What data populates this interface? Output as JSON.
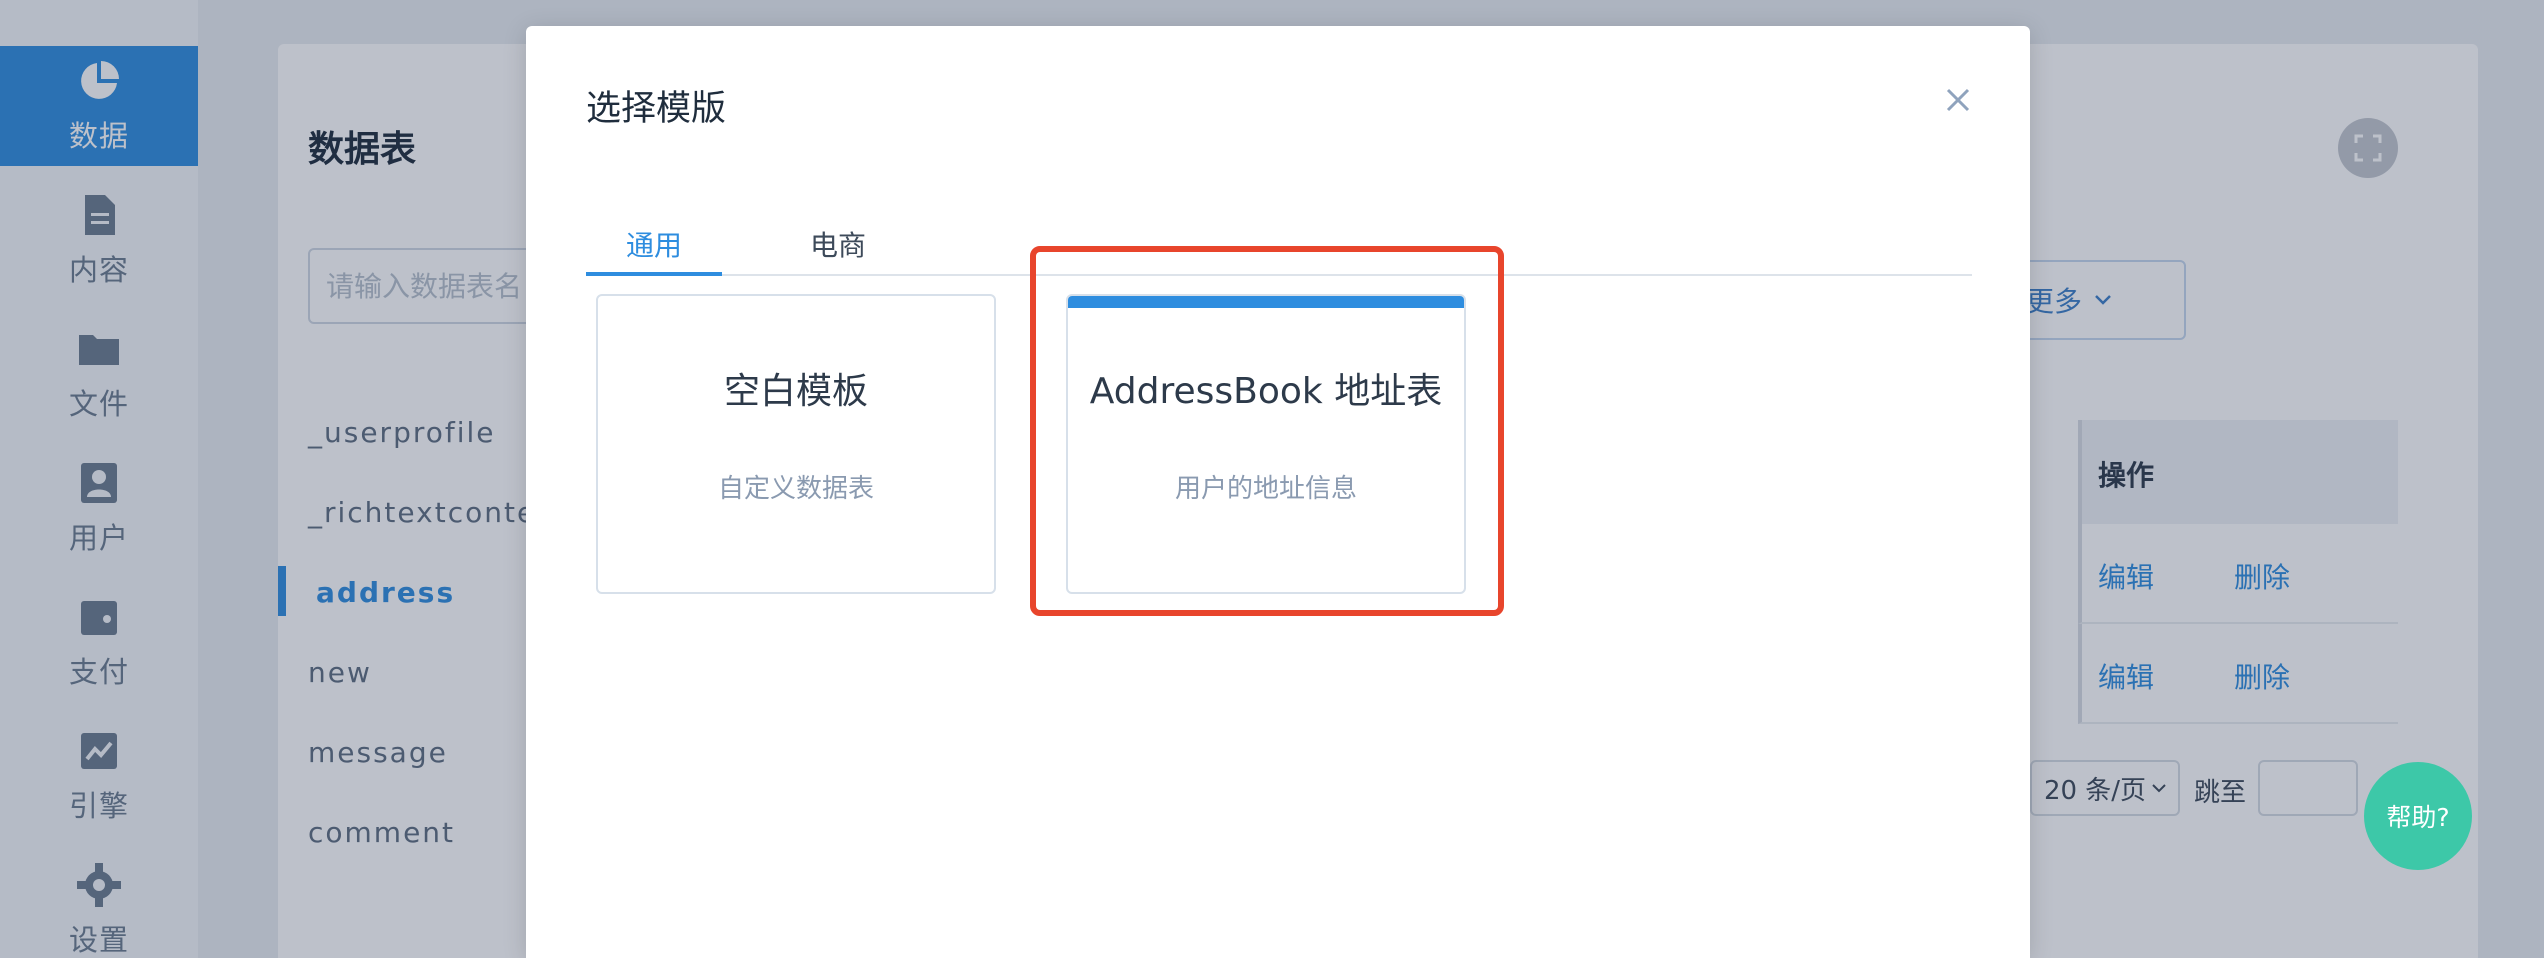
{
  "sidebar": {
    "items": [
      {
        "label": "数据",
        "icon": "pie-chart-icon",
        "active": true
      },
      {
        "label": "内容",
        "icon": "document-icon",
        "active": false
      },
      {
        "label": "文件",
        "icon": "folder-icon",
        "active": false
      },
      {
        "label": "用户",
        "icon": "user-icon",
        "active": false
      },
      {
        "label": "支付",
        "icon": "wallet-icon",
        "active": false
      },
      {
        "label": "引擎",
        "icon": "trend-chart-icon",
        "active": false
      },
      {
        "label": "设置",
        "icon": "gear-icon",
        "active": false
      }
    ]
  },
  "panel": {
    "title": "数据表",
    "search_placeholder": "请输入数据表名",
    "tables": [
      "_userprofile",
      "_richtextconter",
      "address",
      "new",
      "message",
      "comment"
    ],
    "active_table": "address"
  },
  "toolbar": {
    "more_label": "更多"
  },
  "table": {
    "ops_header": "操作",
    "rows": [
      {
        "edit": "编辑",
        "delete": "删除"
      },
      {
        "edit": "编辑",
        "delete": "删除"
      }
    ]
  },
  "pagination": {
    "page_size": "20 条/页",
    "jump_label": "跳至"
  },
  "help": {
    "label": "帮助?"
  },
  "modal": {
    "title": "选择模版",
    "tabs": [
      {
        "label": "通用",
        "active": true
      },
      {
        "label": "电商",
        "active": false
      }
    ],
    "templates": [
      {
        "title": "空白模板",
        "description": "自定义数据表",
        "selected": false
      },
      {
        "title": "AddressBook 地址表",
        "description": "用户的地址信息",
        "selected": true
      }
    ]
  },
  "colors": {
    "accent": "#2e8ddf",
    "highlight": "#e8452c",
    "help": "#3dc8a8"
  }
}
